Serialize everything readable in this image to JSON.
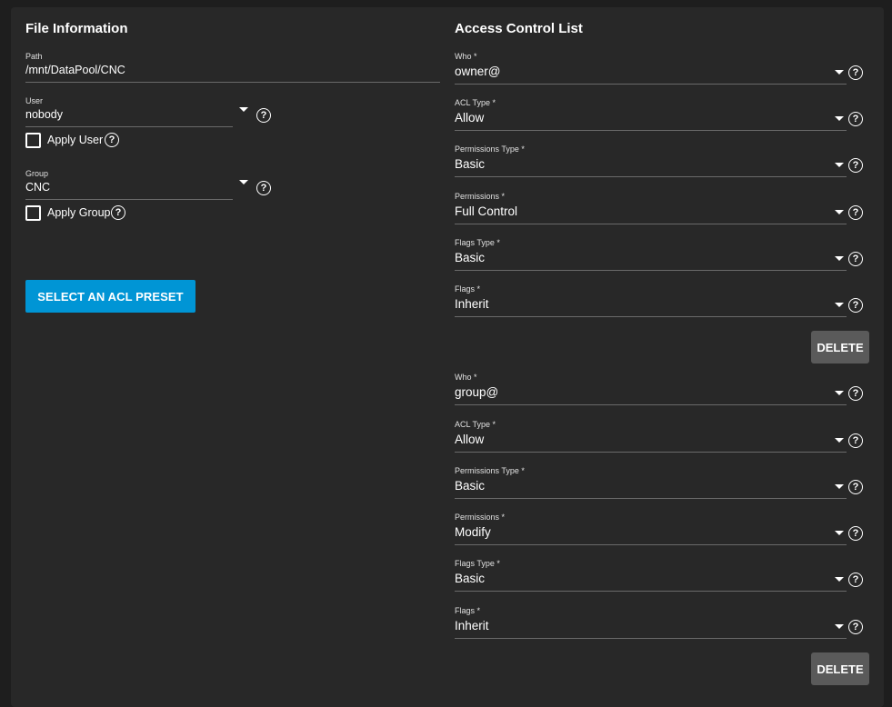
{
  "file_info": {
    "title": "File Information",
    "path": {
      "label": "Path",
      "value": "/mnt/DataPool/CNC"
    },
    "user": {
      "label": "User",
      "value": "nobody",
      "apply_label": "Apply User"
    },
    "group": {
      "label": "Group",
      "value": "CNC",
      "apply_label": "Apply Group"
    },
    "preset_button": "SELECT AN ACL PRESET"
  },
  "acl": {
    "title": "Access Control List",
    "help_glyph": "?",
    "delete_label": "DELETE",
    "entries": [
      {
        "who": {
          "label": "Who *",
          "value": "owner@"
        },
        "acl_type": {
          "label": "ACL Type *",
          "value": "Allow"
        },
        "permissions_type": {
          "label": "Permissions Type *",
          "value": "Basic"
        },
        "permissions": {
          "label": "Permissions *",
          "value": "Full Control"
        },
        "flags_type": {
          "label": "Flags Type *",
          "value": "Basic"
        },
        "flags": {
          "label": "Flags *",
          "value": "Inherit"
        }
      },
      {
        "who": {
          "label": "Who *",
          "value": "group@"
        },
        "acl_type": {
          "label": "ACL Type *",
          "value": "Allow"
        },
        "permissions_type": {
          "label": "Permissions Type *",
          "value": "Basic"
        },
        "permissions": {
          "label": "Permissions *",
          "value": "Modify"
        },
        "flags_type": {
          "label": "Flags Type *",
          "value": "Basic"
        },
        "flags": {
          "label": "Flags *",
          "value": "Inherit"
        }
      }
    ]
  },
  "colors": {
    "background": "#1e1e1e",
    "card": "#282828",
    "primary": "#0095d5",
    "delete_button": "#5a5a5a",
    "divider": "#6a6a6a"
  },
  "icons": {
    "help": "help-circle-icon",
    "dropdown": "caret-down-icon",
    "checkbox": "checkbox-unchecked-icon"
  }
}
